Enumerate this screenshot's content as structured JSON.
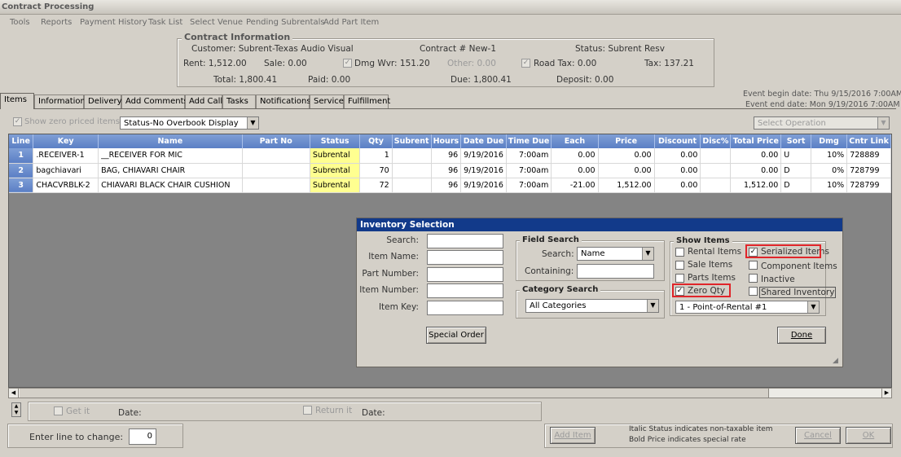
{
  "window": {
    "title": "Contract Processing"
  },
  "menu": [
    "Tools",
    "Reports",
    "Payment History",
    "Task List",
    "Select Venue",
    "Pending Subrentals",
    "Add Part Item"
  ],
  "contract": {
    "legend": "Contract Information",
    "customer": "Customer: Subrent-Texas Audio Visual",
    "contract_no": "Contract # New-1",
    "status": "Status:  Subrent Resv",
    "rent": "Rent: 1,512.00",
    "sale": "Sale:  0.00",
    "dmg_wvr": "Dmg Wvr: 151.20",
    "other": "Other: 0.00",
    "road_tax": "Road Tax:   0.00",
    "tax": "Tax: 137.21",
    "total": "Total: 1,800.41",
    "paid": "Paid: 0.00",
    "due": "Due: 1,800.41",
    "deposit": "Deposit:  0.00"
  },
  "event": {
    "begin": "Event begin date: Thu 9/15/2016 7:00AM",
    "end": "Event end date:   Mon 9/19/2016 7:00AM"
  },
  "tabs": [
    "Items",
    "Information",
    "Delivery",
    "Add Comments",
    "Add Call",
    "Tasks",
    "Notifications",
    "Service",
    "Fulfillment"
  ],
  "toolbar": {
    "show_zero_label": "Show zero priced items",
    "overbook_select": "Status-No Overbook Display",
    "operation_select": "Select Operation"
  },
  "grid": {
    "columns": [
      "Line",
      "Key",
      "Name",
      "Part No",
      "Status",
      "Qty",
      "Subrent",
      "Hours",
      "Date Due",
      "Time Due",
      "Each",
      "Price",
      "Discount",
      "Disc%",
      "Total Price",
      "Sort",
      "Dmg",
      "Cntr Link"
    ],
    "rows": [
      [
        "1",
        ".RECEIVER-1",
        "__RECEIVER FOR MIC",
        "",
        "Subrental",
        "1",
        "",
        "96",
        "9/19/2016",
        "7:00am",
        "0.00",
        "0.00",
        "0.00",
        "",
        "0.00",
        "U",
        "10%",
        "728889"
      ],
      [
        "2",
        "bagchiavari",
        "BAG, CHIAVARI CHAIR",
        "",
        "Subrental",
        "70",
        "",
        "96",
        "9/19/2016",
        "7:00am",
        "0.00",
        "0.00",
        "0.00",
        "",
        "0.00",
        "D",
        "0%",
        "728799"
      ],
      [
        "3",
        "CHACVRBLK-2",
        "CHIAVARI BLACK CHAIR CUSHION",
        "",
        "Subrental",
        "72",
        "",
        "96",
        "9/19/2016",
        "7:00am",
        "-21.00",
        "1,512.00",
        "0.00",
        "",
        "1,512.00",
        "D",
        "10%",
        "728799"
      ]
    ]
  },
  "inventory": {
    "title": "Inventory Selection",
    "labels": {
      "search": "Search:",
      "item_name": "Item Name:",
      "part_number": "Part Number:",
      "item_number": "Item Number:",
      "item_key": "Item Key:"
    },
    "special_order": "Special Order",
    "field_search": {
      "legend": "Field Search",
      "search_label": "Search:",
      "search_value": "Name",
      "containing_label": "Containing:"
    },
    "category_search": {
      "legend": "Category Search",
      "value": "All Categories"
    },
    "show_items": {
      "legend": "Show Items",
      "rental": "Rental Items",
      "sale": "Sale Items",
      "parts": "Parts Items",
      "zero_qty": "Zero Qty",
      "serialized": "Serialized Items",
      "component": "Component Items",
      "inactive": "Inactive",
      "shared": "Shared Inventory",
      "store_select": "1 - Point-of-Rental #1"
    },
    "done": "Done"
  },
  "bottom": {
    "get_it": "Get it",
    "date1": "Date:",
    "return_it": "Return it",
    "date2": "Date:",
    "enter_line": "Enter line to change:",
    "line_value": "0",
    "add_item": "Add Item",
    "note1": "Italic Status indicates non-taxable item",
    "note2": "Bold Price indicates special rate",
    "cancel": "Cancel",
    "ok": "OK"
  }
}
